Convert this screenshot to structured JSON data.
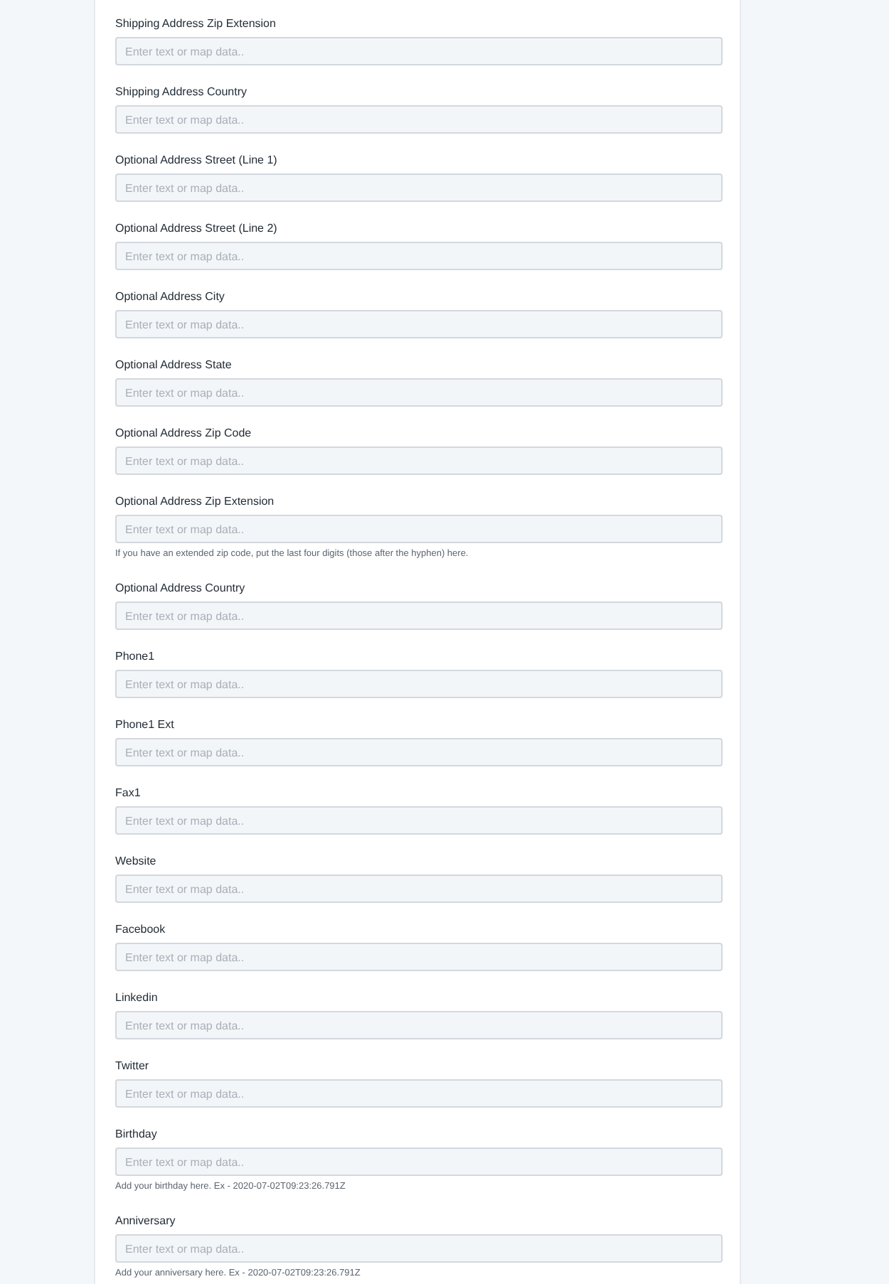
{
  "fields": [
    {
      "label": "Shipping Address Zip Extension",
      "placeholder": "Enter text or map data.."
    },
    {
      "label": "Shipping Address Country",
      "placeholder": "Enter text or map data.."
    },
    {
      "label": "Optional Address Street (Line 1)",
      "placeholder": "Enter text or map data.."
    },
    {
      "label": "Optional Address Street (Line 2)",
      "placeholder": "Enter text or map data.."
    },
    {
      "label": "Optional Address City",
      "placeholder": "Enter text or map data.."
    },
    {
      "label": "Optional Address State",
      "placeholder": "Enter text or map data.."
    },
    {
      "label": "Optional Address Zip Code",
      "placeholder": "Enter text or map data.."
    },
    {
      "label": "Optional Address Zip Extension",
      "placeholder": "Enter text or map data..",
      "hint": "If you have an extended zip code, put the last four digits (those after the hyphen) here."
    },
    {
      "label": "Optional Address Country",
      "placeholder": "Enter text or map data.."
    },
    {
      "label": "Phone1",
      "placeholder": "Enter text or map data.."
    },
    {
      "label": "Phone1 Ext",
      "placeholder": "Enter text or map data.."
    },
    {
      "label": "Fax1",
      "placeholder": "Enter text or map data.."
    },
    {
      "label": "Website",
      "placeholder": "Enter text or map data.."
    },
    {
      "label": "Facebook",
      "placeholder": "Enter text or map data.."
    },
    {
      "label": "Linkedin",
      "placeholder": "Enter text or map data.."
    },
    {
      "label": "Twitter",
      "placeholder": "Enter text or map data.."
    },
    {
      "label": "Birthday",
      "placeholder": "Enter text or map data..",
      "hint": "Add your birthday here. Ex - 2020-07-02T09:23:26.791Z"
    },
    {
      "label": "Anniversary",
      "placeholder": "Enter text or map data..",
      "hint": "Add your anniversary here. Ex - 2020-07-02T09:23:26.791Z"
    }
  ]
}
